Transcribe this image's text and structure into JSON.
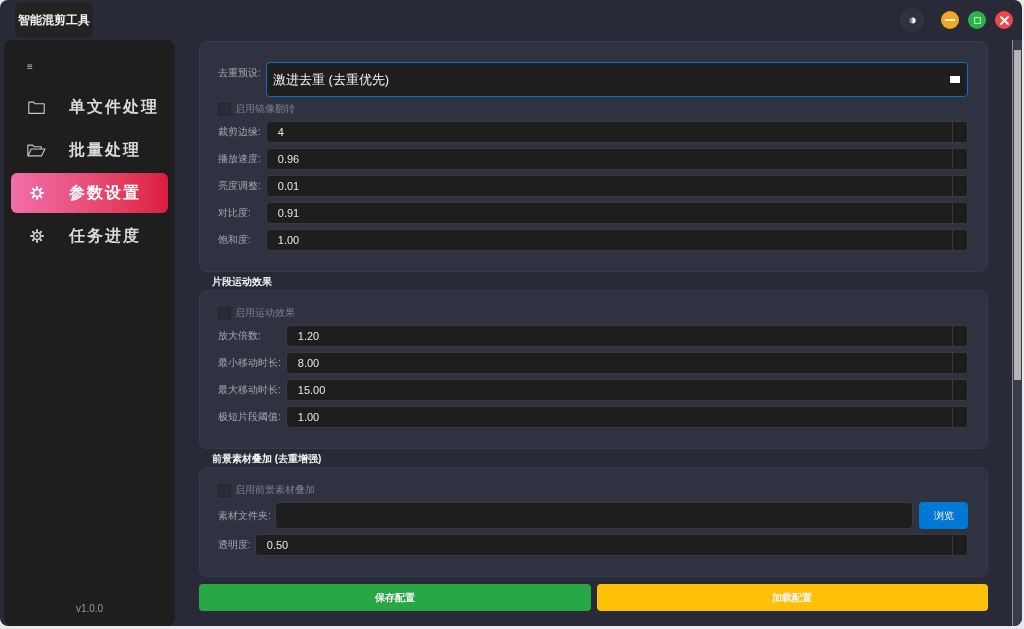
{
  "window": {
    "title": "智能混剪工具"
  },
  "sidebar": {
    "menu_glyph": "≡",
    "items": [
      {
        "label": "单文件处理",
        "selected": false
      },
      {
        "label": "批量处理",
        "selected": false
      },
      {
        "label": "参数设置",
        "selected": true
      },
      {
        "label": "任务进度",
        "selected": false
      }
    ],
    "version": "v1.0.0"
  },
  "groups": [
    {
      "kind": "form",
      "rows": [
        {
          "kind": "combo",
          "label": "去重预设:",
          "value": "激进去重 (去重优先)",
          "focused": true
        },
        {
          "kind": "checkbox",
          "label": "启用镜像翻转",
          "checked": false
        },
        {
          "kind": "spin",
          "label": "裁剪边缘:",
          "value": "4"
        },
        {
          "kind": "spin",
          "label": "播放速度:",
          "value": "0.96"
        },
        {
          "kind": "spin",
          "label": "亮度调整:",
          "value": "0.01"
        },
        {
          "kind": "spin",
          "label": "对比度:",
          "value": "0.91"
        },
        {
          "kind": "spin",
          "label": "饱和度:",
          "value": "1.00"
        }
      ]
    },
    {
      "title": "片段运动效果",
      "kind": "form",
      "rows": [
        {
          "kind": "checkbox",
          "label": "启用运动效果",
          "checked": false
        },
        {
          "kind": "spin",
          "label": "放大倍数:",
          "value": "1.20"
        },
        {
          "kind": "spin",
          "label": "最小移动时长:",
          "value": "8.00"
        },
        {
          "kind": "spin",
          "label": "最大移动时长:",
          "value": "15.00"
        },
        {
          "kind": "spin",
          "label": "极短片段阈值:",
          "value": "1.00"
        }
      ]
    },
    {
      "title": "前景素材叠加 (去重增强)",
      "kind": "rows",
      "rows": [
        {
          "kind": "checkbox",
          "label": "启用前景素材叠加",
          "checked": false
        },
        {
          "kind": "folder",
          "label": "素材文件夹:",
          "button": "浏览"
        },
        {
          "kind": "spin",
          "label": "透明度:",
          "value": "0.50"
        }
      ]
    }
  ],
  "buttons": [
    {
      "label": "保存配置",
      "color": "#28a745"
    },
    {
      "label": "加载配置",
      "color": "#ffc107"
    }
  ]
}
